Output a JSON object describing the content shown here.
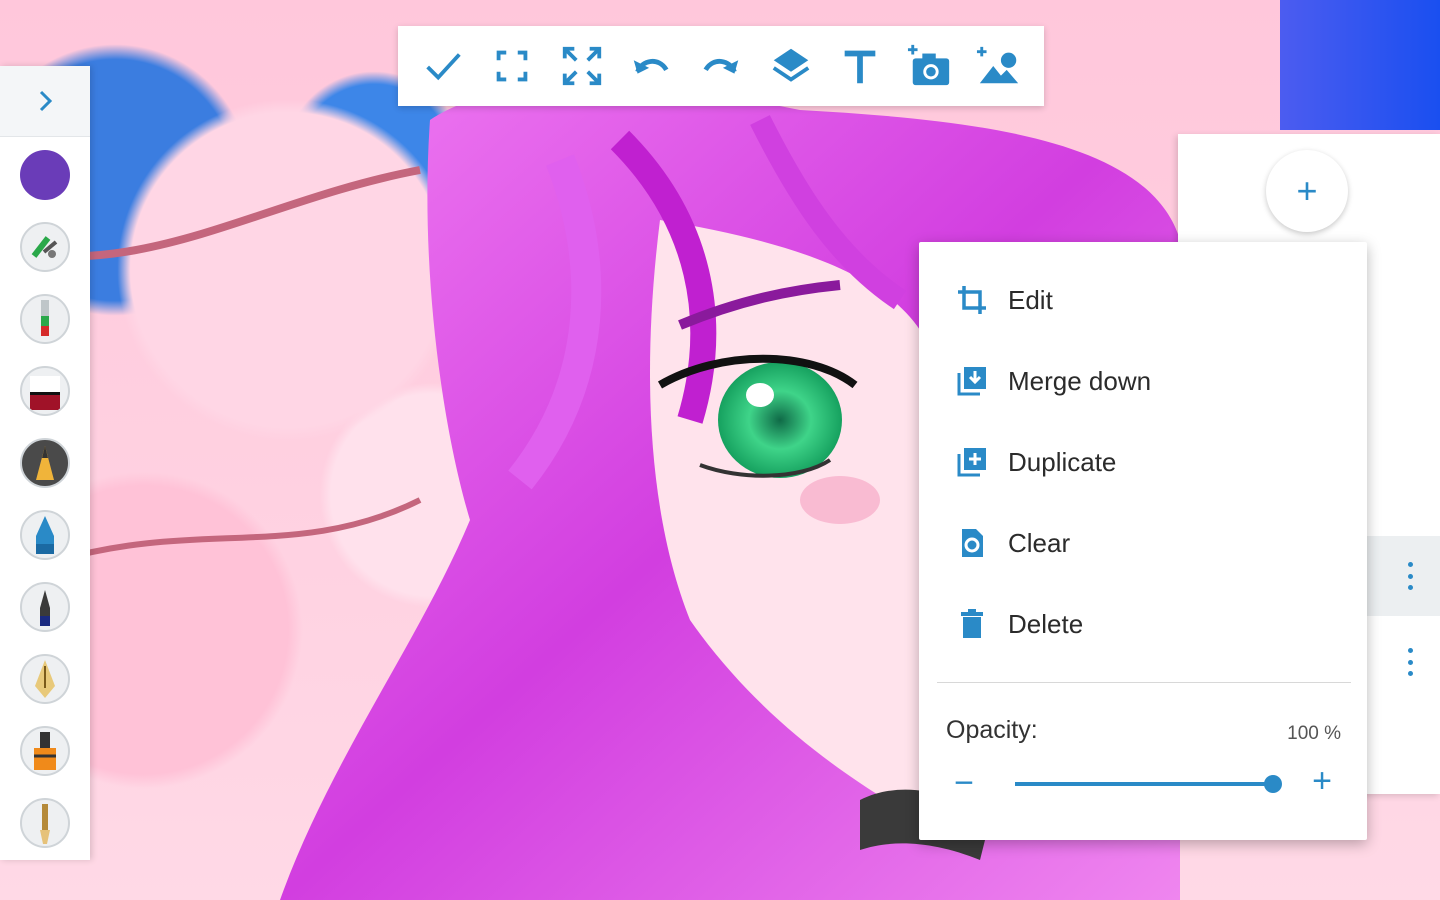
{
  "app": {
    "accent_color": "#2a8ac7"
  },
  "toolbar": {
    "buttons": [
      {
        "name": "check-icon"
      },
      {
        "name": "fit-screen-icon"
      },
      {
        "name": "fullscreen-icon"
      },
      {
        "name": "undo-icon"
      },
      {
        "name": "redo-icon"
      },
      {
        "name": "layers-icon"
      },
      {
        "name": "text-icon"
      },
      {
        "name": "add-photo-icon"
      },
      {
        "name": "add-image-icon"
      }
    ]
  },
  "tool_rail": {
    "current_color": "#6a3cb8",
    "tools": [
      "color-picker",
      "airbrush-icon",
      "marker-icon",
      "eraser-icon",
      "pencil-icon",
      "fill-brush-icon",
      "ink-pen-icon",
      "fountain-pen-icon",
      "highlighter-icon",
      "brush-icon"
    ]
  },
  "layer_panel": {
    "add_label": "+"
  },
  "layer_menu": {
    "items": [
      {
        "label": "Edit",
        "icon": "crop-icon"
      },
      {
        "label": "Merge down",
        "icon": "merge-down-icon"
      },
      {
        "label": "Duplicate",
        "icon": "duplicate-icon"
      },
      {
        "label": "Clear",
        "icon": "clear-icon"
      },
      {
        "label": "Delete",
        "icon": "trash-icon"
      }
    ],
    "opacity_label": "Opacity:",
    "opacity_value": "100 %",
    "opacity_fraction": 1.0,
    "minus_label": "−",
    "plus_label": "+"
  }
}
